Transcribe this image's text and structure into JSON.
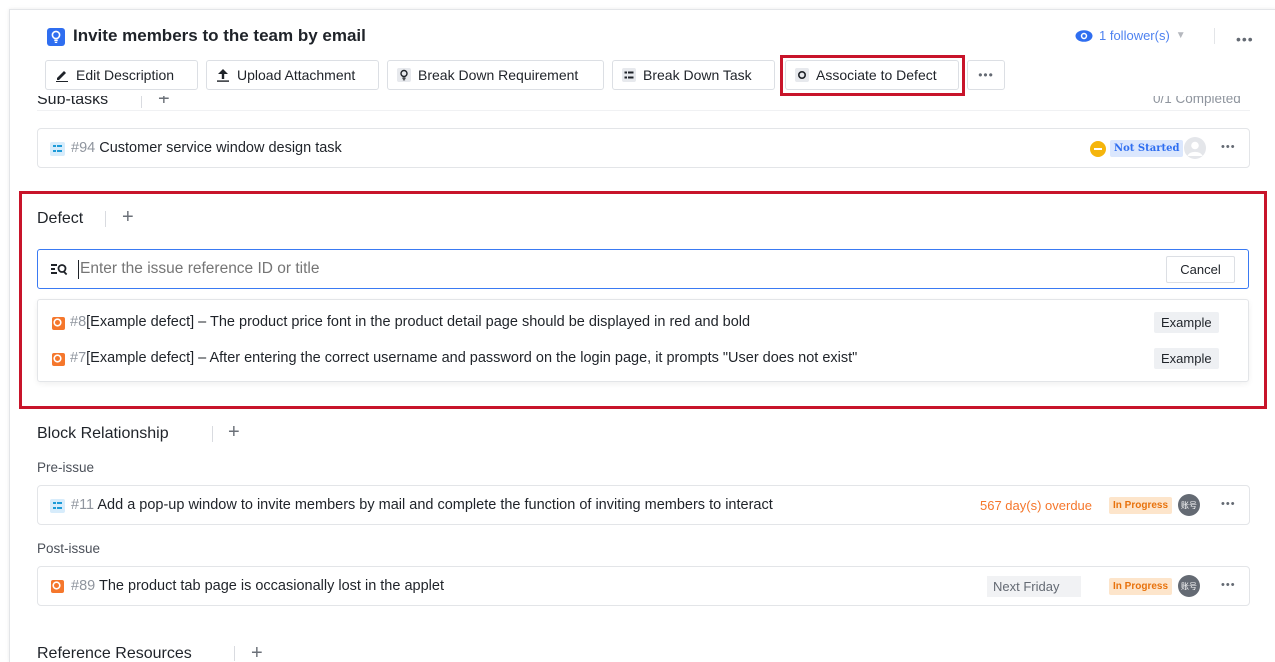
{
  "header": {
    "title": "Invite members to the team by email",
    "follower": "1 follower(s)",
    "more_glyph": "•••"
  },
  "toolbar": {
    "edit_description": "Edit Description",
    "upload_attachment": "Upload Attachment",
    "break_down_requirement": "Break Down Requirement",
    "break_down_task": "Break Down Task",
    "associate_to_defect": "Associate to Defect",
    "more_glyph": "•••"
  },
  "subtasks": {
    "title": "Sub-tasks",
    "completed": "0/1 Completed",
    "rows": [
      {
        "id": "#94",
        "title": "Customer service window design task",
        "status": "Not Started"
      }
    ]
  },
  "defect": {
    "title": "Defect",
    "add_glyph": "+",
    "search_placeholder": "Enter the issue reference ID or title",
    "cancel_label": "Cancel",
    "results": [
      {
        "id": "#8",
        "title": "[Example defect] – The product price font in the product detail page should be displayed in red and bold",
        "tag": "Example"
      },
      {
        "id": "#7",
        "title": "[Example defect] – After entering the correct username and password on the login page, it prompts \"User does not exist\"",
        "tag": "Example"
      }
    ]
  },
  "block_relationship": {
    "title": "Block Relationship",
    "add_glyph": "+",
    "pre_label": "Pre-issue",
    "pre_issue": {
      "id": "#11",
      "title": "Add a pop-up window to invite members by mail and complete the function of inviting members to interact",
      "overdue": "567 day(s) overdue",
      "status": "In Progress",
      "avatar_text": "账号"
    },
    "post_label": "Post-issue",
    "post_issue": {
      "id": "#89",
      "title": "The product tab page is occasionally lost in the applet",
      "due": "Next Friday",
      "status": "In Progress",
      "avatar_text": "账号"
    }
  },
  "reference": {
    "title": "Reference Resources",
    "add_glyph": "+"
  },
  "colors": {
    "accent": "#2f6ef0",
    "highlight": "#c8142a",
    "overdue": "#f5772c",
    "in_progress_bg": "#fde5cb",
    "in_progress_text": "#e8720c",
    "not_started_bg": "#dbe7fd",
    "not_started_text": "#2f6ef0"
  }
}
